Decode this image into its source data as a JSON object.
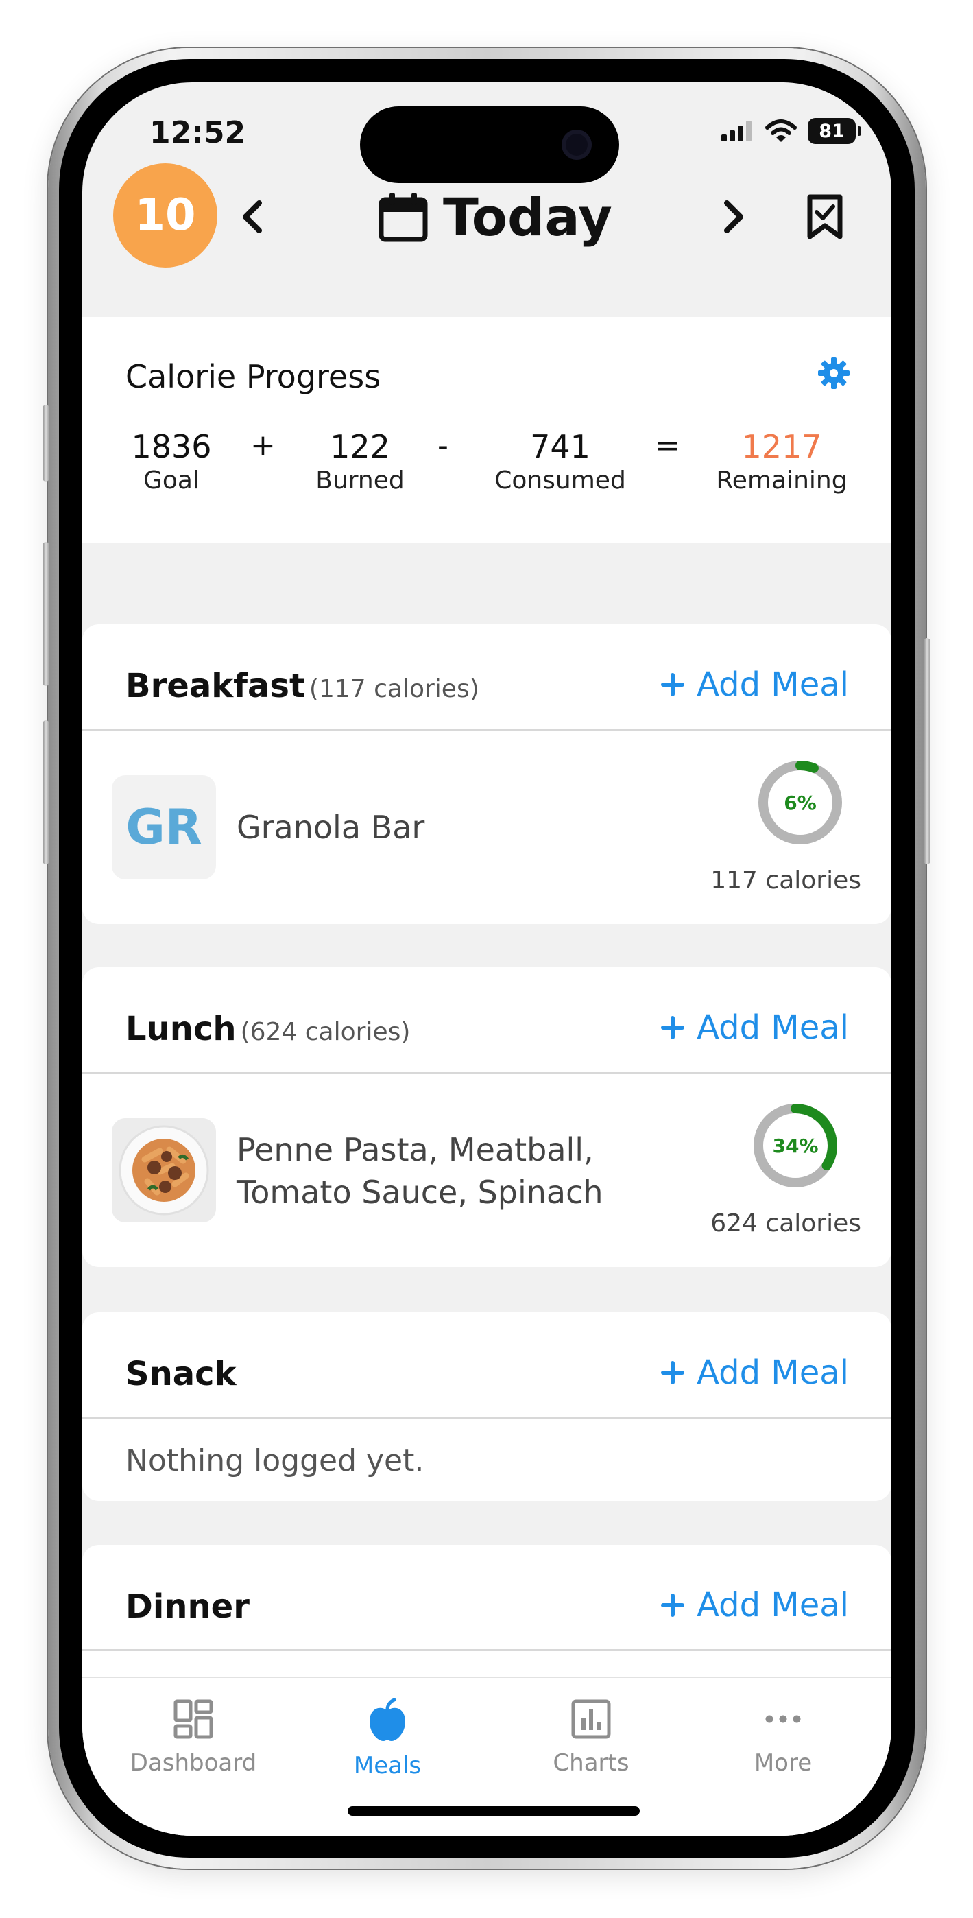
{
  "status_bar": {
    "time": "12:52",
    "battery": "81"
  },
  "header": {
    "streak": "10",
    "title": "Today"
  },
  "calorie_progress": {
    "title": "Calorie Progress",
    "goal_value": "1836",
    "goal_label": "Goal",
    "plus": "+",
    "burned_value": "122",
    "burned_label": "Burned",
    "minus": "-",
    "consumed_value": "741",
    "consumed_label": "Consumed",
    "equals": "=",
    "remaining_value": "1217",
    "remaining_label": "Remaining",
    "remaining_color": "#f07a4c"
  },
  "meals": {
    "add_meal_label": "Add Meal",
    "breakfast": {
      "name": "Breakfast",
      "calories": "(117 calories)",
      "items": [
        {
          "thumb": "GR",
          "name": "Granola Bar",
          "percent_label": "6%",
          "percent": 0.06,
          "calories": "117 calories"
        }
      ]
    },
    "lunch": {
      "name": "Lunch",
      "calories": "(624 calories)",
      "items": [
        {
          "name_line1": "Penne Pasta, Meatball,",
          "name_line2": "Tomato Sauce, Spinach",
          "percent_label": "34%",
          "percent": 0.34,
          "calories": "624 calories"
        }
      ]
    },
    "snack": {
      "name": "Snack",
      "empty_text": "Nothing logged yet."
    },
    "dinner": {
      "name": "Dinner"
    }
  },
  "tabs": [
    {
      "label": "Dashboard",
      "icon": "dashboard-icon",
      "active": false
    },
    {
      "label": "Meals",
      "icon": "apple-icon",
      "active": true
    },
    {
      "label": "Charts",
      "icon": "bar-chart-icon",
      "active": false
    },
    {
      "label": "More",
      "icon": "more-icon",
      "active": false
    }
  ],
  "colors": {
    "accent": "#1f8ee8",
    "streak": "#f8a44c",
    "ring_fill": "#1e8a1e",
    "ring_track": "#b5b5b5",
    "inactive_tab": "#8e8e8e"
  }
}
